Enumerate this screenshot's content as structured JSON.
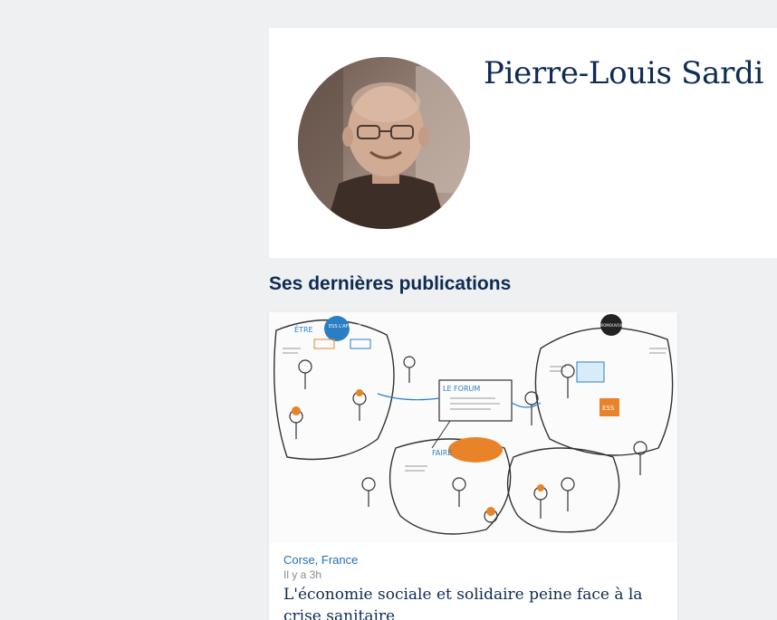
{
  "author": {
    "name": "Pierre-Louis Sardi",
    "avatar_icon": "author-portrait"
  },
  "publications": {
    "heading": "Ses dernières publications",
    "articles": [
      {
        "location": "Corse, France",
        "time": "Il y a 3h",
        "title": "L'économie sociale et solidaire peine face à la crise sanitaire",
        "illustration_icon": "sketchnote-illustration",
        "illustration_words": [
          "ÊTRE",
          "ESS L'AFFICHE",
          "LE FORUM",
          "FAIRE",
          "PROMOUVOIR L'ESS",
          "ESS"
        ]
      }
    ]
  },
  "colors": {
    "background": "#eff0f1",
    "name_color": "#0d2b54",
    "link_color": "#1f6fb5",
    "accent_orange": "#e8832a",
    "accent_blue": "#2a7fc4"
  }
}
